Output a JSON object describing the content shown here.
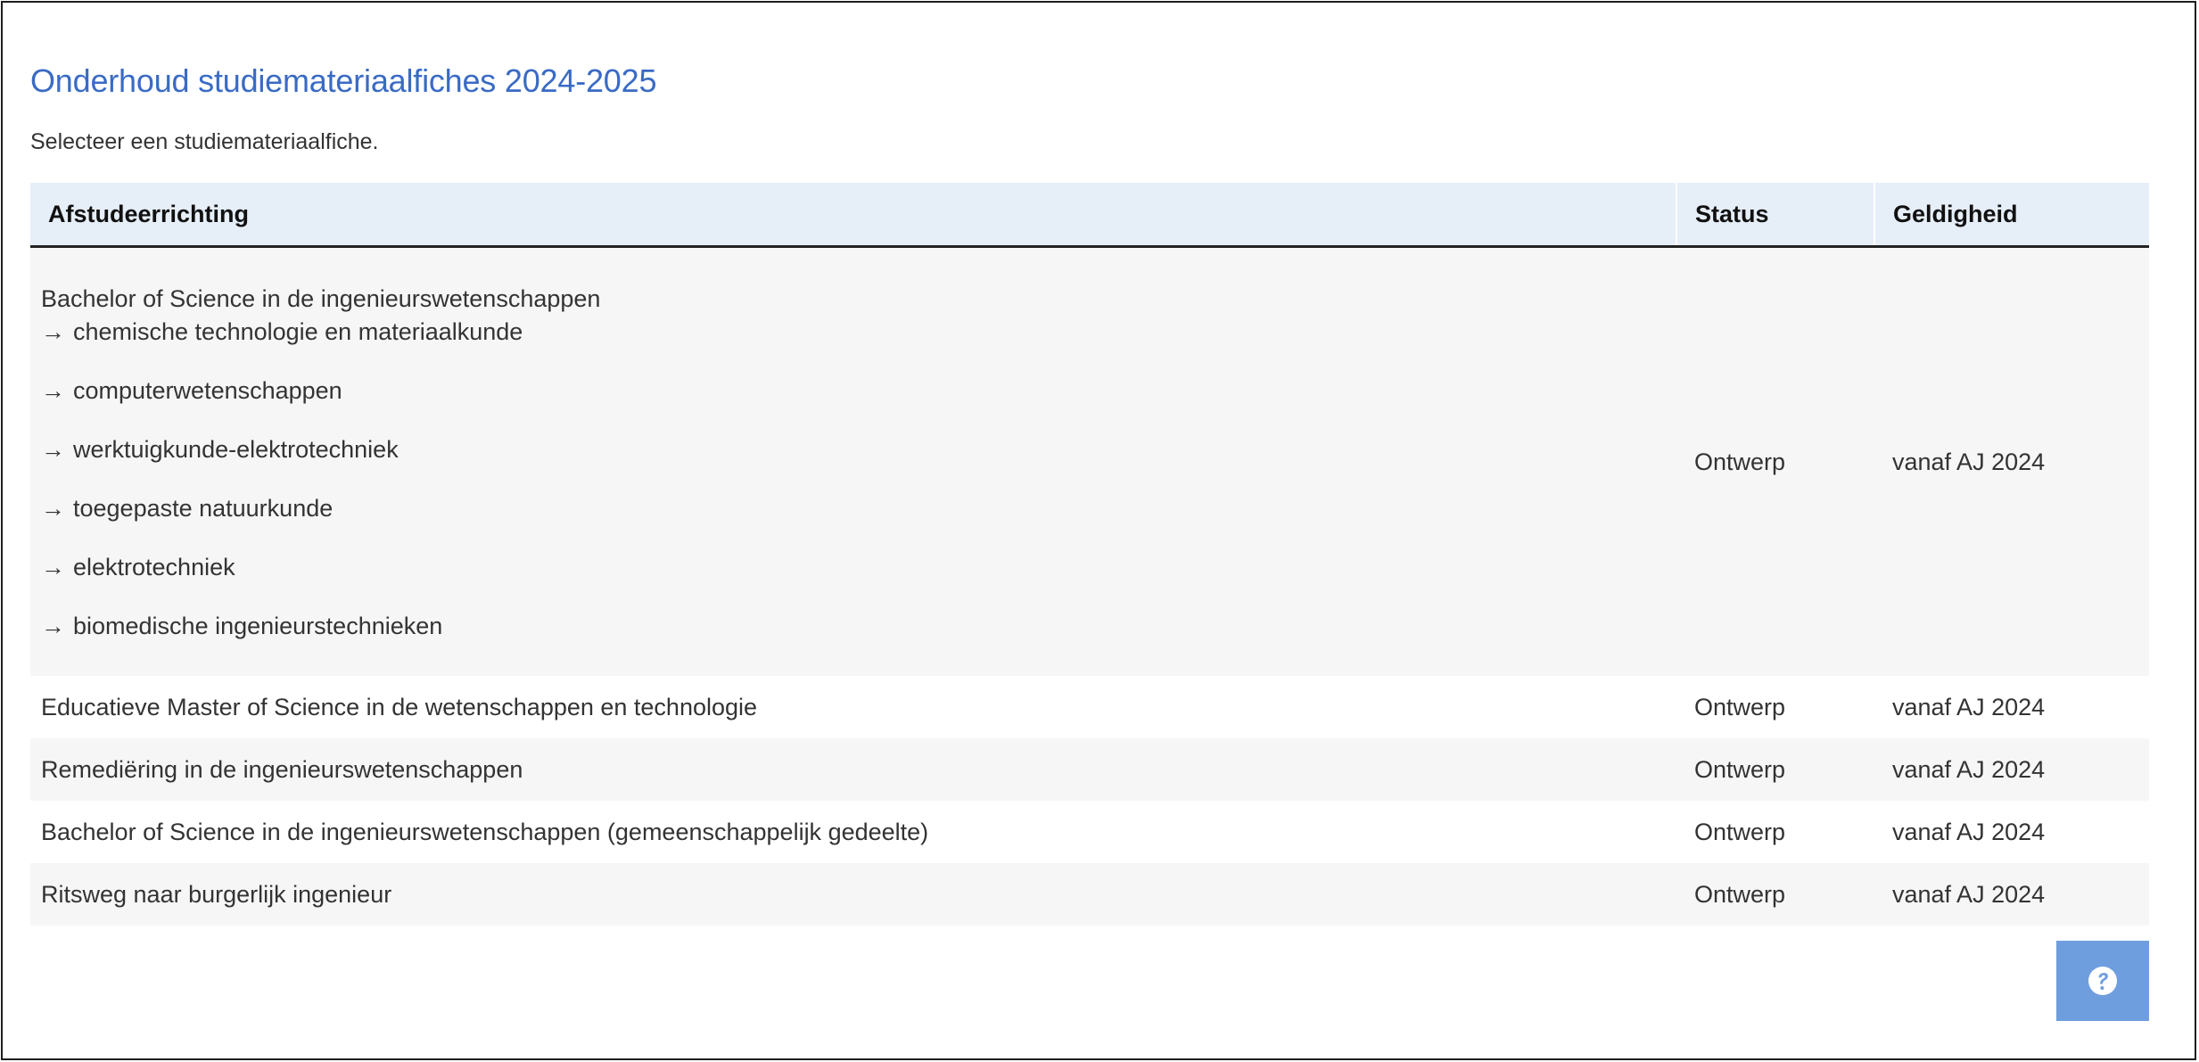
{
  "page": {
    "title": "Onderhoud studiemateriaalfiches 2024-2025",
    "intro": "Selecteer een studiemateriaalfiche."
  },
  "table": {
    "headers": {
      "name": "Afstudeerrichting",
      "status": "Status",
      "validity": "Geldigheid"
    },
    "main_row": {
      "title": "Bachelor of Science in de ingenieurswetenschappen",
      "arrow": "→",
      "subitems": [
        "chemische technologie en materiaalkunde",
        "computerwetenschappen",
        "werktuigkunde-elektrotechniek",
        "toegepaste natuurkunde",
        "elektrotechniek",
        "biomedische ingenieurstechnieken"
      ],
      "status": "Ontwerp",
      "validity": "vanaf AJ 2024"
    },
    "rows": [
      {
        "name": "Educatieve Master of Science in de wetenschappen en technologie",
        "status": "Ontwerp",
        "validity": "vanaf AJ 2024"
      },
      {
        "name": "Remediëring in de ingenieurswetenschappen",
        "status": "Ontwerp",
        "validity": "vanaf AJ 2024"
      },
      {
        "name": "Bachelor of Science in de ingenieurswetenschappen (gemeenschappelijk gedeelte)",
        "status": "Ontwerp",
        "validity": "vanaf AJ 2024"
      },
      {
        "name": "Ritsweg naar burgerlijk ingenieur",
        "status": "Ontwerp",
        "validity": "vanaf AJ 2024"
      }
    ]
  },
  "help": {
    "icon": "help-icon",
    "color": "#6f9edf"
  },
  "colors": {
    "title": "#3a6bc4",
    "header_background": "#e6eef8",
    "row_stripe": "#f6f6f6"
  }
}
